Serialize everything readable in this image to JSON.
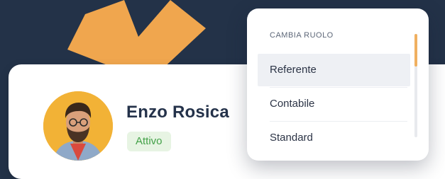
{
  "user": {
    "name": "Enzo Rosica",
    "status": "Attivo"
  },
  "role_menu": {
    "header": "CAMBIA RUOLO",
    "options": [
      {
        "label": "Referente",
        "selected": true
      },
      {
        "label": "Contabile",
        "selected": false
      },
      {
        "label": "Standard",
        "selected": false
      }
    ]
  },
  "colors": {
    "background": "#233248",
    "accent": "#f0a64e",
    "status_text": "#43a148",
    "status_bg": "#e7f4e3"
  }
}
